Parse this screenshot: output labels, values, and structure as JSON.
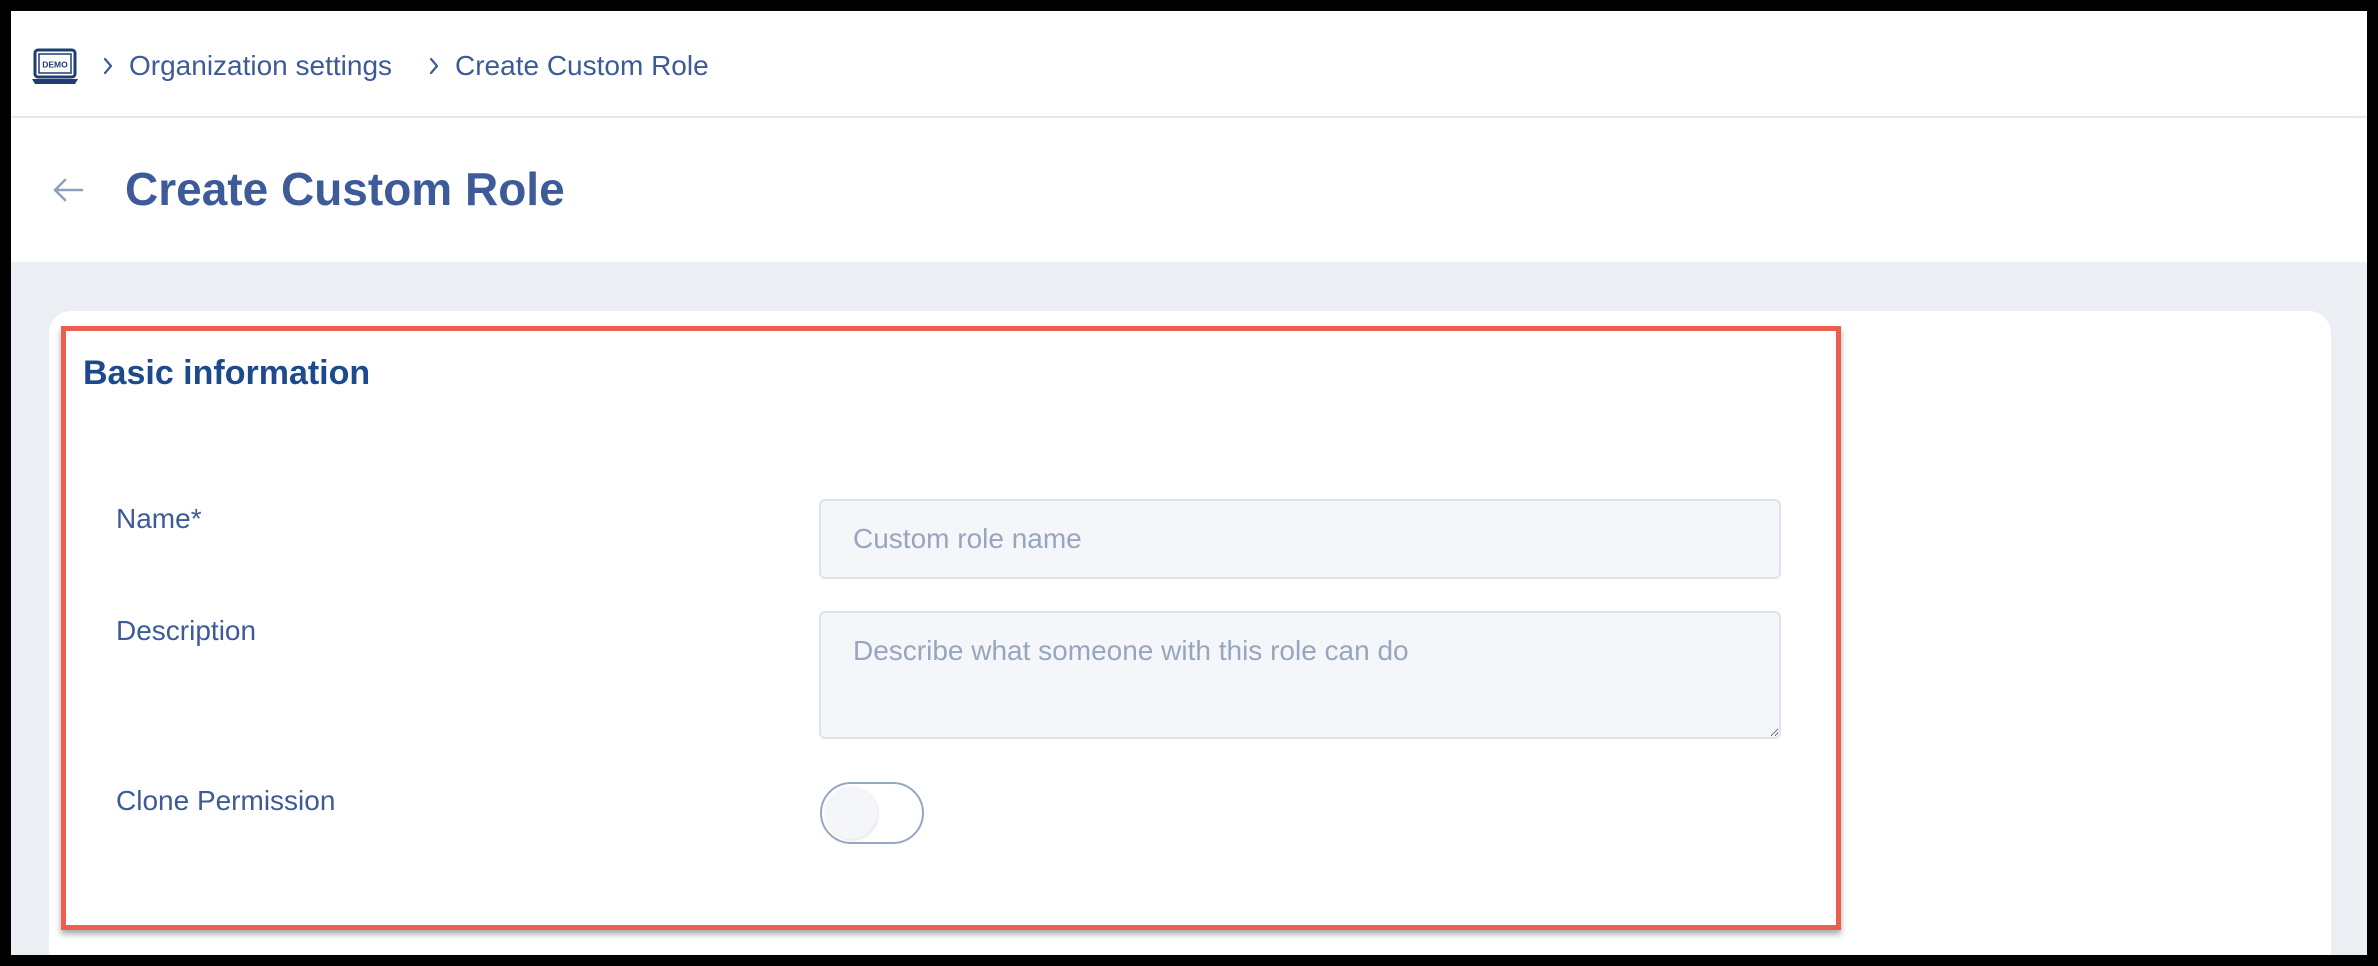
{
  "breadcrumb": {
    "logo_label": "DEMO",
    "items": [
      {
        "label": "Organization settings"
      },
      {
        "label": "Create Custom Role"
      }
    ]
  },
  "header": {
    "title": "Create Custom Role"
  },
  "basic_info": {
    "title": "Basic information",
    "name_label": "Name*",
    "name_placeholder": "Custom role name",
    "name_value": "",
    "description_label": "Description",
    "description_placeholder": "Describe what someone with this role can do",
    "description_value": "",
    "clone_label": "Clone Permission",
    "clone_enabled": false
  },
  "colors": {
    "accent": "#3d5a99",
    "section_title": "#1d4a8c",
    "highlight": "#ea5f50",
    "page_bg": "#ebeef3"
  },
  "icons": {
    "logo": "demo-laptop-icon",
    "separator": "chevron-right-icon",
    "back": "arrow-left-icon"
  }
}
